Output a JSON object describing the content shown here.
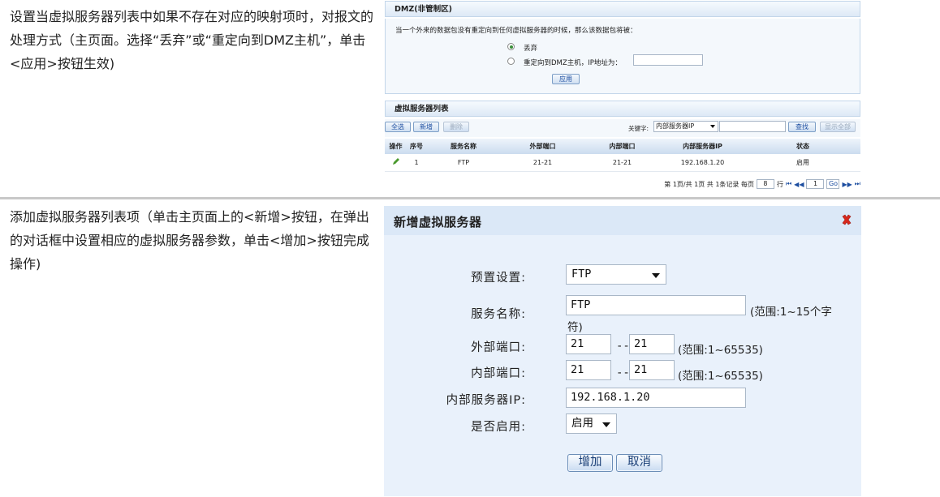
{
  "row1": {
    "description": "设置当虚拟服务器列表中如果不存在对应的映射项时，对报文的处理方式（主页面。选择“丢弃”或“重定向到DMZ主机”，单击<应用>按钮生效)"
  },
  "row2": {
    "description": "添加虚拟服务器列表项（单击主页面上的<新增>按钮，在弹出的对话框中设置相应的虚拟服务器参数，单击<增加>按钮完成操作)"
  },
  "dmz": {
    "title": "DMZ(非管制区)",
    "description": "当一个外来的数据包没有重定向到任何虚拟服务器的时候，那么该数据包将被：",
    "option_drop": "丢弃",
    "option_redirect": "重定向到DMZ主机，IP地址为：",
    "selected": "丢弃",
    "ip_value": "",
    "apply_button": "应用"
  },
  "vs_list": {
    "title": "虚拟服务器列表",
    "select_all_button": "全选",
    "new_button": "新增",
    "delete_button": "删除",
    "search_label": "关键字:",
    "search_field_value": "内部服务器IP",
    "search_value": "",
    "search_button": "查找",
    "show_all_button": "显示全部",
    "columns": [
      "操作",
      "序号",
      "服务名称",
      "外部端口",
      "内部端口",
      "内部服务器IP",
      "状态"
    ],
    "rows": [
      {
        "index": "1",
        "service": "FTP",
        "ext_port": "21-21",
        "int_port": "21-21",
        "ip": "192.168.1.20",
        "status": "启用"
      }
    ],
    "pager": {
      "page_info": "第 1页/共 1页 共 1条记录 每页",
      "page_size": "8",
      "goto_label": "行",
      "goto_value": "1",
      "go_button": "Go"
    }
  },
  "dialog": {
    "title": "新增虚拟服务器",
    "preset_label": "预置设置:",
    "preset_value": "FTP",
    "service_name_label": "服务名称:",
    "service_name_value": "FTP",
    "service_name_hint_1": "(范围:1~15个字",
    "service_name_hint_2": "符)",
    "ext_port_label": "外部端口:",
    "ext_port_start": "21",
    "ext_port_end": "21",
    "ext_port_hint": "(范围:1~65535)",
    "int_port_label": "内部端口:",
    "int_port_start": "21",
    "int_port_end": "21",
    "int_port_hint": "(范围:1~65535)",
    "port_separator": "--",
    "ip_label": "内部服务器IP:",
    "ip_value": "192.168.1.20",
    "enable_label": "是否启用:",
    "enable_value": "启用",
    "add_button": "增加",
    "cancel_button": "取消"
  }
}
